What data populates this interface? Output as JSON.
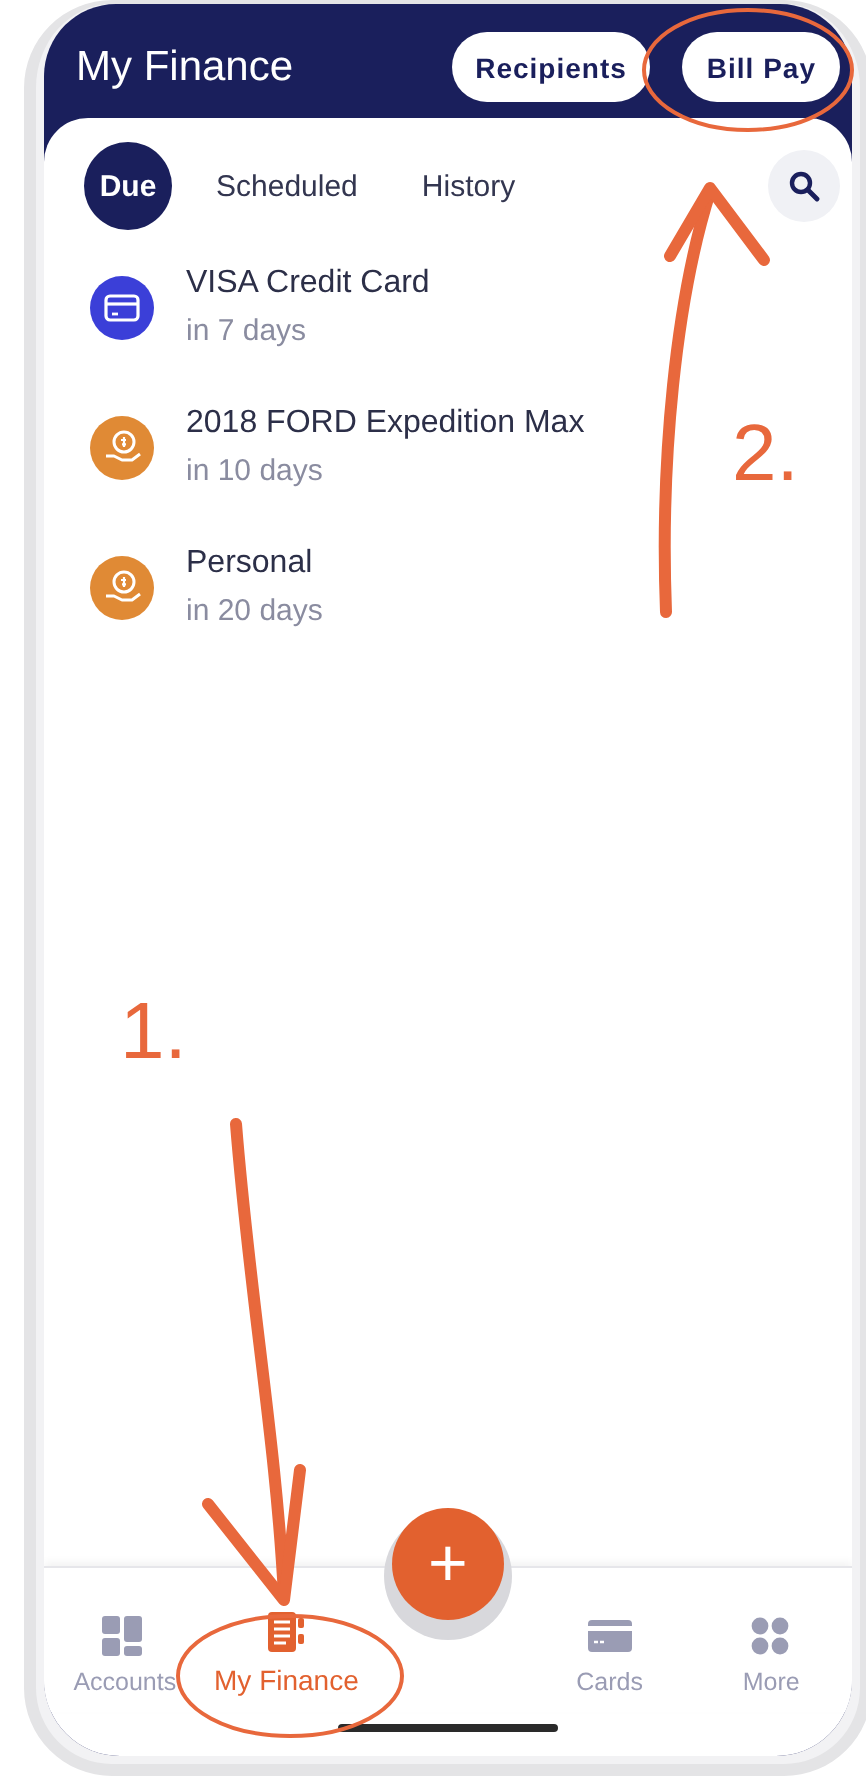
{
  "header": {
    "title": "My Finance",
    "buttons": [
      {
        "label": "Recipients"
      },
      {
        "label": "Bill Pay"
      }
    ]
  },
  "tabs": [
    {
      "label": "Due",
      "selected": true
    },
    {
      "label": "Scheduled",
      "selected": false
    },
    {
      "label": "History",
      "selected": false
    }
  ],
  "payments": [
    {
      "title": "VISA Credit Card",
      "due": "in 7 days",
      "kind": "card",
      "color": "#3b3fd8"
    },
    {
      "title": "2018 FORD Expedition Max",
      "due": "in 10 days",
      "kind": "coin",
      "color": "#e08a35"
    },
    {
      "title": "Personal",
      "due": "in 20 days",
      "kind": "coin",
      "color": "#e08a35"
    }
  ],
  "fab": {
    "label": "+"
  },
  "nav": [
    {
      "label": "Accounts",
      "kind": "accounts",
      "selected": false
    },
    {
      "label": "My Finance",
      "kind": "finance",
      "selected": true
    },
    {
      "label": "Cards",
      "kind": "cards",
      "selected": false
    },
    {
      "label": "More",
      "kind": "more",
      "selected": false
    }
  ],
  "annotations": [
    {
      "label": "1."
    },
    {
      "label": "2."
    }
  ]
}
